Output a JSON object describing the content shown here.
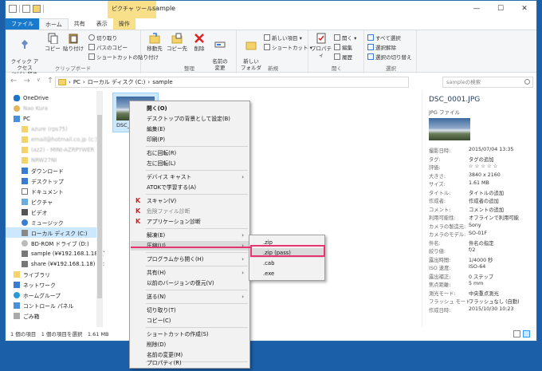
{
  "titlebar": {
    "picture_tools": "ピクチャ ツール",
    "title": "sample",
    "minimize": "—",
    "maximize": "☐",
    "close": "✕"
  },
  "tabs": {
    "file": "ファイル",
    "home": "ホーム",
    "share": "共有",
    "view": "表示",
    "manage": "操作"
  },
  "ribbon": {
    "clipboard": {
      "label": "クリップボード",
      "pin": "クイック アクセス\nにピン留め",
      "copy": "コピー",
      "paste": "貼り付け",
      "cut": "切り取り",
      "copy_path": "パスのコピー",
      "paste_shortcut": "ショートカットの貼り付け"
    },
    "organize": {
      "label": "整理",
      "move_to": "移動先",
      "copy_to": "コピー先",
      "delete": "削除",
      "rename": "名前の\n変更"
    },
    "new": {
      "label": "新規",
      "new_folder": "新しい\nフォルダー",
      "new_item": "新しい項目 ▾",
      "shortcut": "ショートカット ▾"
    },
    "open": {
      "label": "開く",
      "properties": "プロパティ",
      "open": "開く ▾",
      "edit": "編集",
      "history": "履歴"
    },
    "select": {
      "label": "選択",
      "select_all": "すべて選択",
      "select_none": "選択解除",
      "invert": "選択の切り替え"
    }
  },
  "address": {
    "path": [
      "PC",
      "ローカル ディスク (C:)",
      "sample"
    ],
    "search_placeholder": "sampleの検索"
  },
  "nav": {
    "items": [
      {
        "label": "OneDrive"
      },
      {
        "label": "Nao Kura"
      },
      {
        "label": "PC"
      },
      {
        "label": "azure (rps75)"
      },
      {
        "label": "email@hotmail.co.jp (c:)"
      },
      {
        "label": "(az2) - MINI-AZRPYWER"
      },
      {
        "label": "NRW27NI"
      },
      {
        "label": "ダウンロード"
      },
      {
        "label": "デスクトップ"
      },
      {
        "label": "ドキュメント"
      },
      {
        "label": "ピクチャ"
      },
      {
        "label": "ビデオ"
      },
      {
        "label": "ミュージック"
      },
      {
        "label": "ローカル ディスク (C:)"
      },
      {
        "label": "BD-ROM ドライブ (D:)"
      },
      {
        "label": "sample (¥¥192.168.1.18) (Y:)"
      },
      {
        "label": "share (¥¥192.168.1.18) (Z:)"
      },
      {
        "label": "ライブラリ"
      },
      {
        "label": "ネットワーク"
      },
      {
        "label": "ホームグループ"
      },
      {
        "label": "コントロール パネル"
      },
      {
        "label": "ごみ箱"
      }
    ]
  },
  "content": {
    "file_label": "DSC_0"
  },
  "details": {
    "filename": "DSC_0001.JPG",
    "filetype": "JPG ファイル",
    "props": [
      {
        "k": "撮影日時:",
        "v": "2015/07/04 13:35"
      },
      {
        "k": "タグ:",
        "v": "タグの追加"
      },
      {
        "k": "評価:",
        "v": "☆ ☆ ☆ ☆ ☆"
      },
      {
        "k": "大きさ:",
        "v": "3840 x 2160"
      },
      {
        "k": "サイズ:",
        "v": "1.61 MB"
      },
      {
        "k": "タイトル:",
        "v": "タイトルの追加"
      },
      {
        "k": "作成者:",
        "v": "作成者の追加"
      },
      {
        "k": "コメント:",
        "v": "コメントの追加"
      },
      {
        "k": "利用可能性:",
        "v": "オフラインで利用可能"
      },
      {
        "k": "カメラの製造元:",
        "v": "Sony"
      },
      {
        "k": "カメラのモデル:",
        "v": "SO-01F"
      },
      {
        "k": "件名:",
        "v": "件名の指定"
      },
      {
        "k": "絞り値:",
        "v": "f/2"
      },
      {
        "k": "露出時間:",
        "v": "1/4000 秒"
      },
      {
        "k": "ISO 速度:",
        "v": "ISO-64"
      },
      {
        "k": "露出補正:",
        "v": "0 ステップ"
      },
      {
        "k": "焦点距離:",
        "v": "5 mm"
      },
      {
        "k": "測光モード:",
        "v": "中央重点測光"
      },
      {
        "k": "フラッシュ モード:",
        "v": "フラッシュなし (自動)"
      },
      {
        "k": "作成日時:",
        "v": "2015/10/30 10:23"
      }
    ]
  },
  "status": {
    "text": "1 個の項目　1 個の項目を選択　1.61 MB"
  },
  "context_menu": {
    "items": [
      "開く(O)",
      "デスクトップの背景として設定(B)",
      "編集(E)",
      "印刷(P)",
      "右に回転(R)",
      "左に回転(L)",
      "デバイス キャスト",
      "ATOKで学習する(A)",
      "スキャン(V)",
      "危険ファイル診断",
      "アプリケーション診断",
      "解凍(E)",
      "圧縮(U)",
      "プログラムから開く(H)",
      "共有(H)",
      "以前のバージョンの復元(V)",
      "送る(N)",
      "切り取り(T)",
      "コピー(C)",
      "ショートカットの作成(S)",
      "削除(D)",
      "名前の変更(M)",
      "プロパティ(R)"
    ]
  },
  "submenu": {
    "items": [
      ".zip",
      ".zip (pass)",
      ".cab",
      ".exe"
    ]
  }
}
